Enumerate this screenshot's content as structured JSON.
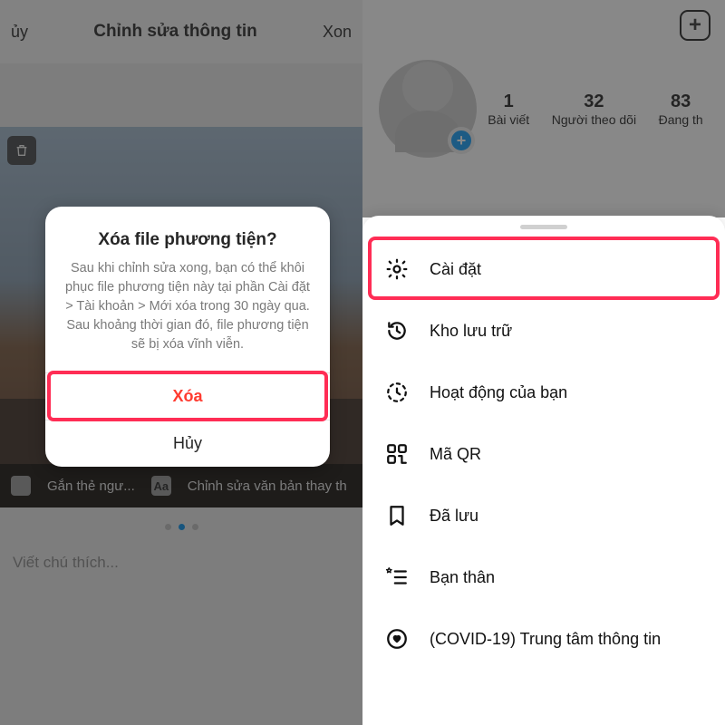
{
  "left": {
    "header": {
      "cancel": "ủy",
      "title": "Chỉnh sửa thông tin",
      "done": "Xon"
    },
    "edit_strip": {
      "tag": "Gắn thẻ ngư...",
      "alt": "Chỉnh sửa văn bản thay th"
    },
    "pager_active_index": 1,
    "caption_placeholder": "Viết chú thích...",
    "alert": {
      "title": "Xóa file phương tiện?",
      "message": "Sau khi chỉnh sửa xong, bạn có thể khôi phục file phương tiện này tại phần Cài đặt > Tài khoản > Mới xóa trong 30 ngày qua. Sau khoảng thời gian đó, file phương tiện sẽ bị xóa vĩnh viễn.",
      "delete": "Xóa",
      "cancel": "Hủy"
    }
  },
  "right": {
    "stats": [
      {
        "num": "1",
        "lbl": "Bài viết"
      },
      {
        "num": "32",
        "lbl": "Người theo dõi"
      },
      {
        "num": "83",
        "lbl": "Đang th"
      }
    ],
    "sheet": {
      "items": [
        {
          "id": "settings",
          "label": "Cài đặt"
        },
        {
          "id": "archive",
          "label": "Kho lưu trữ"
        },
        {
          "id": "activity",
          "label": "Hoạt động của bạn"
        },
        {
          "id": "qr",
          "label": "Mã QR"
        },
        {
          "id": "saved",
          "label": "Đã lưu"
        },
        {
          "id": "close",
          "label": "Bạn thân"
        },
        {
          "id": "covid",
          "label": "(COVID-19) Trung tâm thông tin"
        }
      ]
    }
  }
}
